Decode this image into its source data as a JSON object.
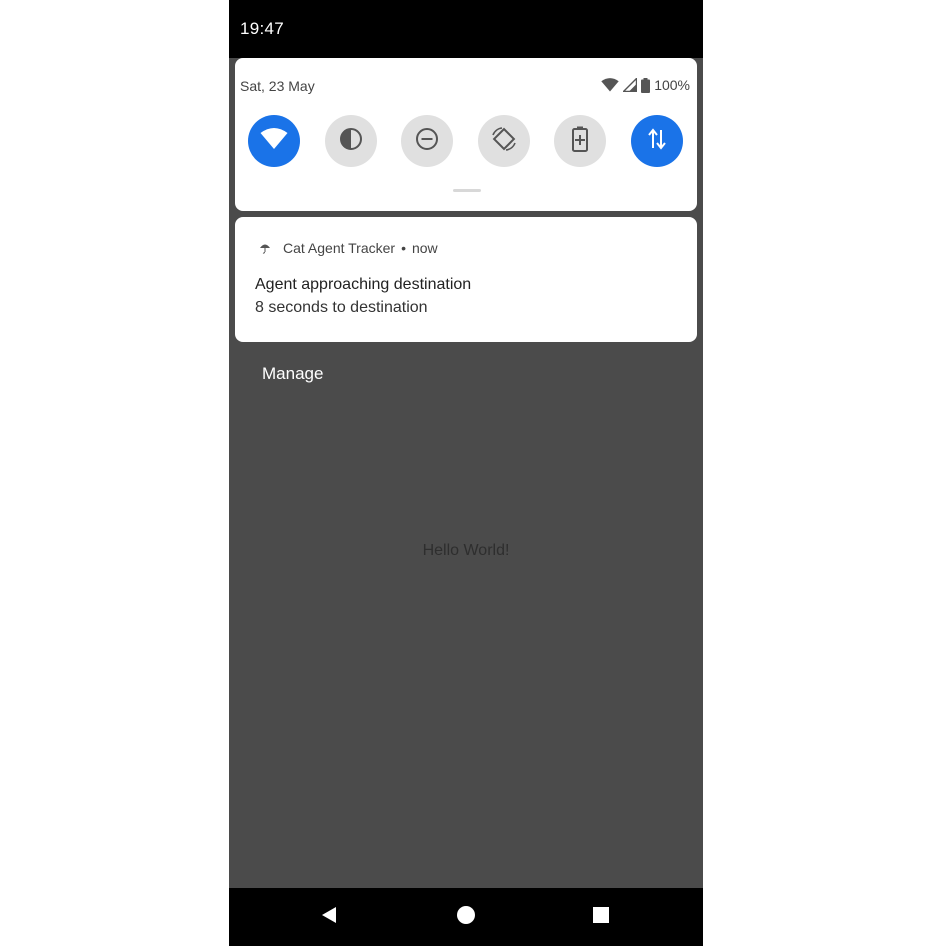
{
  "status_bar": {
    "time": "19:47"
  },
  "quick_settings": {
    "date": "Sat, 23 May",
    "battery": "100%",
    "tiles": [
      {
        "icon": "wifi-icon",
        "state": "on"
      },
      {
        "icon": "invert-colors-icon",
        "state": "off"
      },
      {
        "icon": "do-not-disturb-icon",
        "state": "off"
      },
      {
        "icon": "auto-rotate-icon",
        "state": "off"
      },
      {
        "icon": "battery-saver-icon",
        "state": "off"
      },
      {
        "icon": "mobile-data-icon",
        "state": "on"
      }
    ]
  },
  "notification": {
    "app_name": "Cat Agent Tracker",
    "separator": "•",
    "time": "now",
    "title": "Agent approaching destination",
    "text": "8 seconds to destination"
  },
  "manage_label": "Manage",
  "app": {
    "content_text": "Hello World!"
  },
  "colors": {
    "accent": "#1a73e8",
    "tile_off": "#e0e0e0",
    "app_bg": "#4b4b4b"
  }
}
